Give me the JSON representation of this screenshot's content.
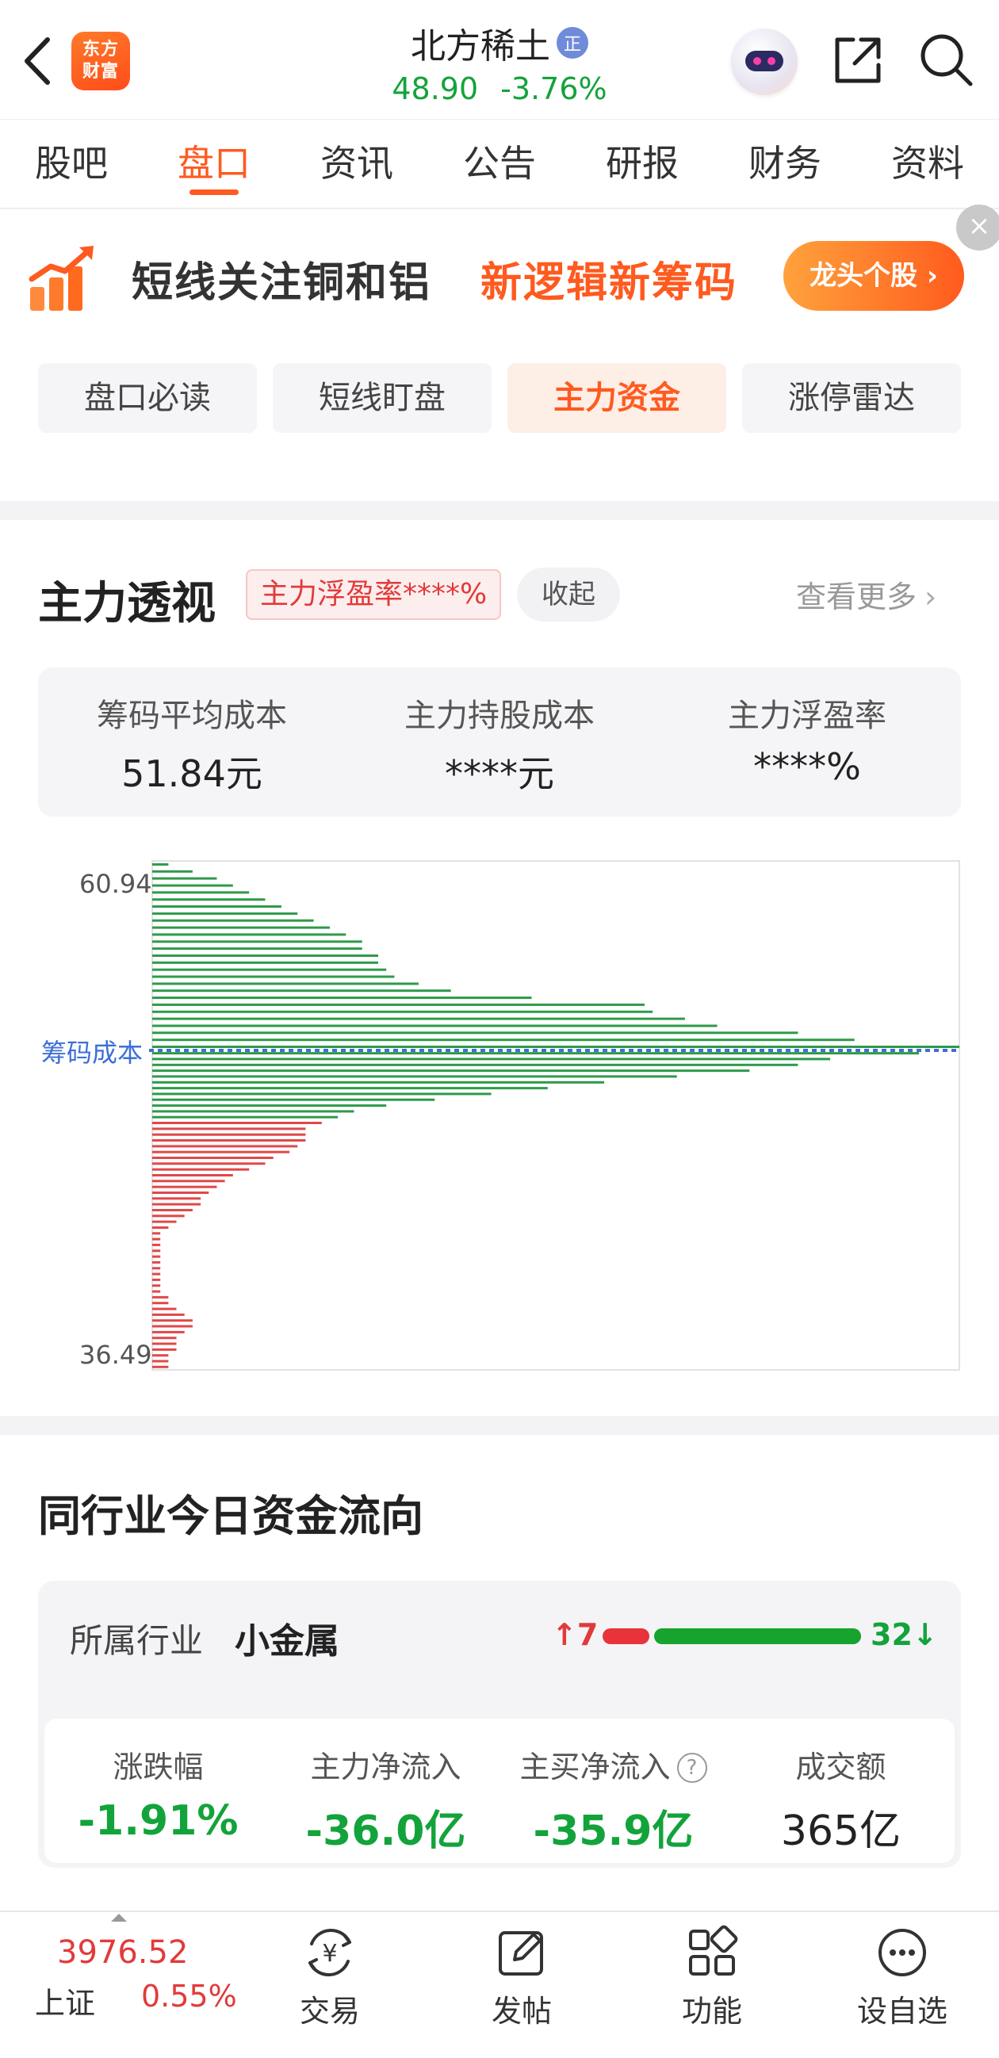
{
  "header": {
    "stock_name": "北方稀土",
    "badge": "正",
    "price": "48.90",
    "change_pct": "-3.76%",
    "logo_line1": "东方",
    "logo_line2": "财富"
  },
  "tabs": [
    {
      "label": "股吧"
    },
    {
      "label": "盘口",
      "active": true
    },
    {
      "label": "资讯"
    },
    {
      "label": "公告"
    },
    {
      "label": "研报"
    },
    {
      "label": "财务"
    },
    {
      "label": "资料"
    }
  ],
  "banner": {
    "title": "短线关注铜和铝",
    "subtitle": "新逻辑新筹码",
    "button": "龙头个股",
    "close": "×"
  },
  "subtabs": [
    {
      "label": "盘口必读"
    },
    {
      "label": "短线盯盘"
    },
    {
      "label": "主力资金",
      "active": true
    },
    {
      "label": "涨停雷达"
    }
  ],
  "main_force": {
    "title": "主力透视",
    "rate_badge": "主力浮盈率****%",
    "collapse": "收起",
    "more": "查看更多",
    "stats": [
      {
        "label": "筹码平均成本",
        "value": "51.84元"
      },
      {
        "label": "主力持股成本",
        "value": "****元"
      },
      {
        "label": "主力浮盈率",
        "value": "****%"
      }
    ]
  },
  "chart_data": {
    "type": "bar",
    "orientation": "horizontal",
    "y_top_label": "60.94",
    "y_bottom_label": "36.49",
    "ylim": [
      36.49,
      60.94
    ],
    "cost_label": "筹码成本",
    "cost_value": 51.84,
    "profit_color": "#e04848",
    "loss_color": "#2e9a4a",
    "cost_line_color": "#3d6fd6",
    "xlim": [
      0,
      100
    ],
    "bars_above_cost": [
      2,
      5,
      8,
      10,
      12,
      14,
      16,
      18,
      20,
      22,
      24,
      26,
      26,
      28,
      28,
      29,
      30,
      33,
      37,
      47,
      61,
      62,
      66,
      70,
      80,
      87,
      100
    ],
    "bars_below_cost": [
      95,
      84,
      80,
      74,
      65,
      56,
      49,
      42,
      35,
      29,
      25,
      23,
      21,
      19,
      19,
      19,
      18,
      17,
      15,
      14,
      12,
      10,
      9,
      8,
      7,
      6,
      6,
      5,
      4,
      3,
      2,
      1,
      1,
      1,
      1,
      1,
      1,
      1,
      1,
      1,
      1,
      1,
      2,
      2,
      3,
      4,
      5,
      5,
      4,
      3,
      3,
      3,
      2,
      2,
      2
    ]
  },
  "industry": {
    "title": "同行业今日资金流向",
    "label": "所属行业",
    "name": "小金属",
    "up_count": "7",
    "down_count": "32",
    "up_ratio": 0.18,
    "stats": [
      {
        "label": "涨跌幅",
        "value": "-1.91%",
        "color": "#13a33b"
      },
      {
        "label": "主力净流入",
        "value": "-36.0亿",
        "color": "#13a33b"
      },
      {
        "label": "主买净流入",
        "value": "-35.9亿",
        "color": "#13a33b"
      },
      {
        "label": "成交额",
        "value": "365亿",
        "color": "#222222"
      }
    ]
  },
  "bottom_bar": {
    "index_value": "3976.52",
    "index_name": "上证",
    "index_change": "0.55%",
    "items": [
      {
        "label": "交易",
        "icon": "trade-yen-icon"
      },
      {
        "label": "发帖",
        "icon": "edit-post-icon"
      },
      {
        "label": "功能",
        "icon": "grid-functions-icon"
      },
      {
        "label": "设自选",
        "icon": "more-dots-icon"
      }
    ]
  }
}
